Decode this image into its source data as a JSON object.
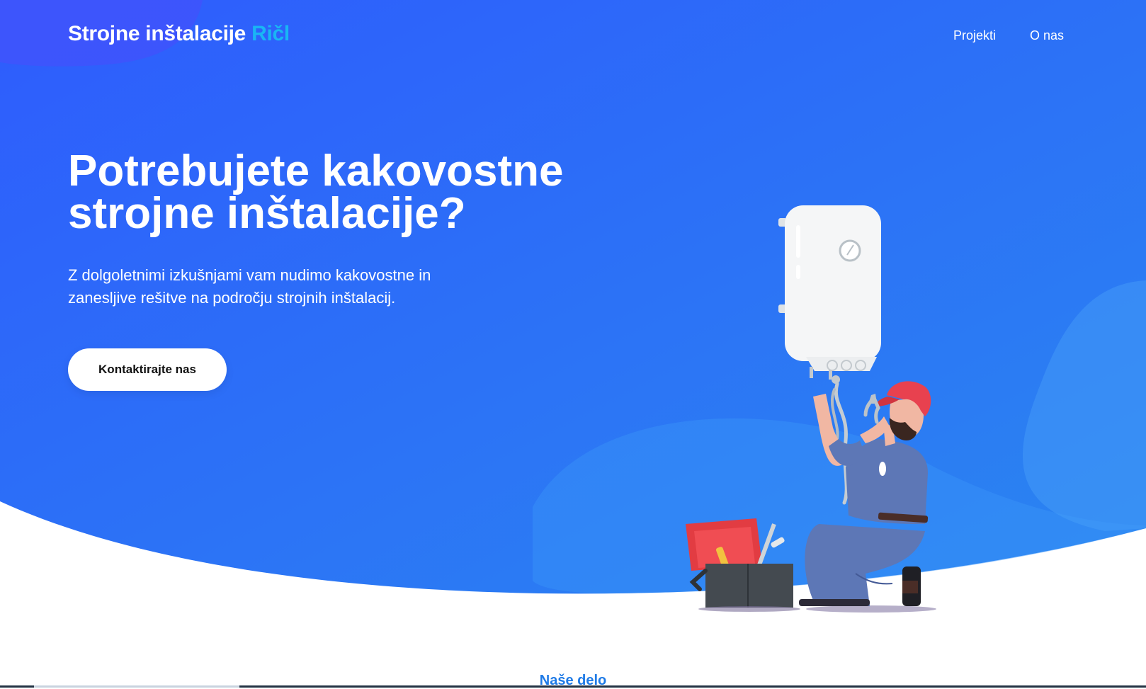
{
  "brand": {
    "name": "Strojne inštalacije",
    "accent": "Ričl"
  },
  "nav": {
    "items": [
      "Projekti",
      "O nas"
    ]
  },
  "hero": {
    "title_line1": "Potrebujete kakovostne",
    "title_line2": "strojne inštalacije?",
    "subtitle_line1": "Z dolgoletnimi izkušnjami vam nudimo kakovostne in",
    "subtitle_line2": "zanesljive rešitve na področju strojnih inštalacij.",
    "cta_label": "Kontaktirajte nas"
  },
  "section": {
    "heading": "Naše delo"
  },
  "colors": {
    "hero_gradient_start": "#2e5cfd",
    "hero_gradient_end": "#2a86f0",
    "brand_accent": "#19b6f4",
    "heading_blue": "#1e7ae6",
    "cta_background": "#ffffff",
    "cap_red": "#e8414f",
    "overalls_blue": "#5d77b6"
  },
  "illustration": {
    "icon": "plumber-water-heater-illustration"
  }
}
